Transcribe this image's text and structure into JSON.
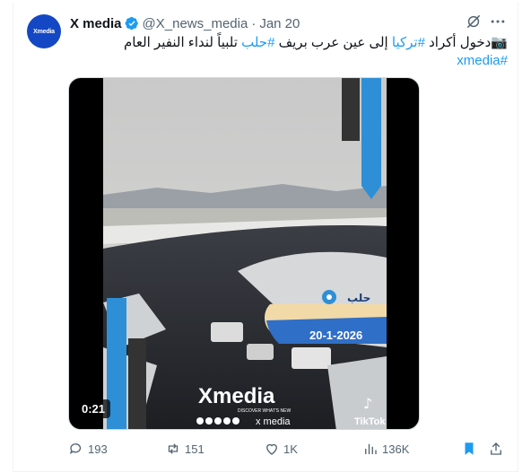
{
  "post": {
    "author_name": "X media",
    "handle": "@X_news_media",
    "separator": "·",
    "date": "Jan 20",
    "avatar_text": "Xmedia",
    "text_parts": [
      {
        "text": "📷",
        "tag": false
      },
      {
        "text": "دخول أكراد ",
        "tag": false
      },
      {
        "text": "#تركيا",
        "tag": true
      },
      {
        "text": " إلى عين عرب بريف ",
        "tag": false
      },
      {
        "text": "#حلب",
        "tag": true
      },
      {
        "text": " تلبياً لنداء النفير العام",
        "tag": false
      }
    ],
    "hashtag_line": "#xmedia"
  },
  "video": {
    "duration": "0:21",
    "overlay_location": "حلب",
    "overlay_date": "20-1-2026",
    "watermark": "Xmedia",
    "watermark_tagline": "DISCOVER WHAT'S NEW",
    "watermark_small": "x media",
    "tiktok": "TikTok"
  },
  "actions": {
    "replies": "193",
    "reposts": "151",
    "likes": "1K",
    "views": "136K"
  },
  "colors": {
    "accent": "#1d9bf0",
    "avatar_bg": "#1447c4",
    "secondary_text": "#536471"
  }
}
